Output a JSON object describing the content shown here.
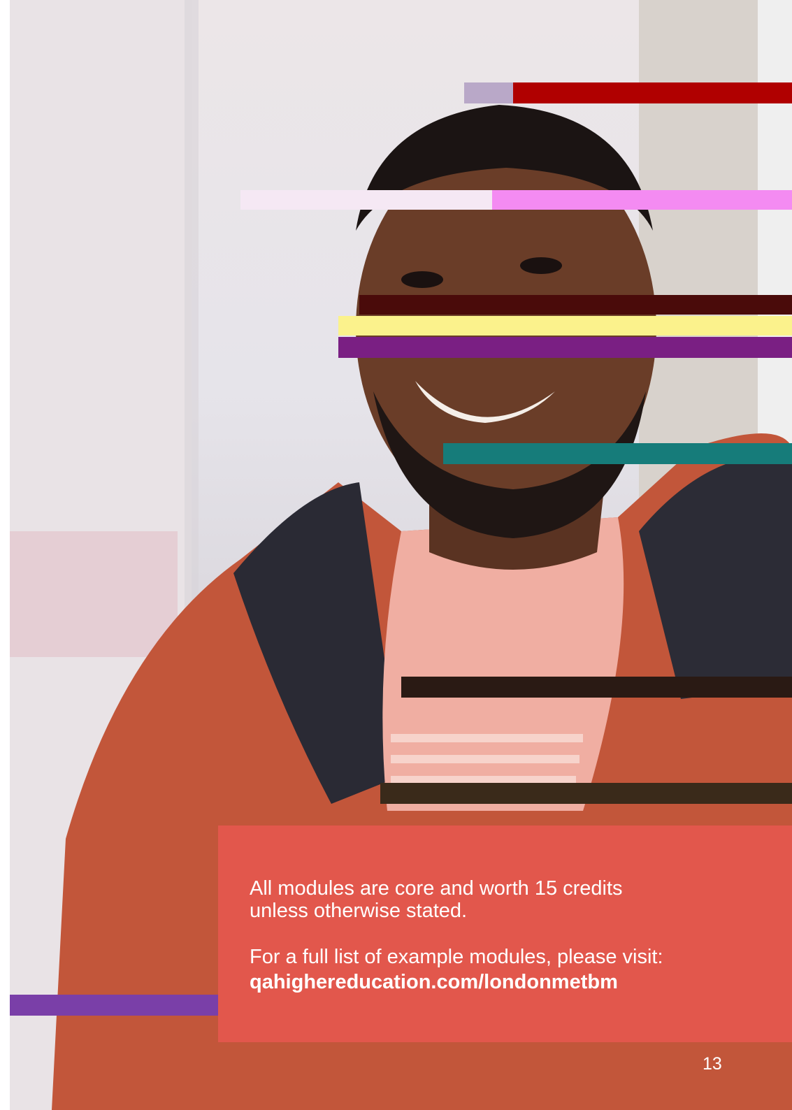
{
  "photo": {
    "subject": "smiling-man-photo"
  },
  "info_box": {
    "line_1": "All modules are core and worth 15 credits",
    "line_2": "unless otherwise stated.",
    "visit_text": "For a full list of example modules, please visit:",
    "url": "qahighereducation.com/londonmetbm"
  },
  "footer": {
    "page_number": "13"
  },
  "colors": {
    "info_box_background": "#e2574c",
    "text": "#ffffff"
  }
}
